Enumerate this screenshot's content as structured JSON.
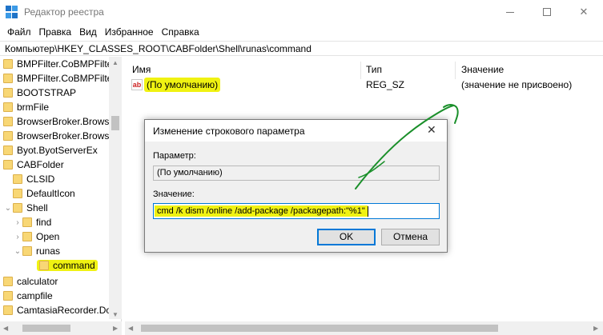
{
  "window": {
    "title": "Редактор реестра"
  },
  "menu": [
    "Файл",
    "Правка",
    "Вид",
    "Избранное",
    "Справка"
  ],
  "address": "Компьютер\\HKEY_CLASSES_ROOT\\CABFolder\\Shell\\runas\\command",
  "tree": [
    {
      "label": "BMPFilter.CoBMPFilte",
      "level": 0
    },
    {
      "label": "BMPFilter.CoBMPFilte",
      "level": 0
    },
    {
      "label": "BOOTSTRAP",
      "level": 0
    },
    {
      "label": "brmFile",
      "level": 0
    },
    {
      "label": "BrowserBroker.Browse",
      "level": 0
    },
    {
      "label": "BrowserBroker.Browse",
      "level": 0
    },
    {
      "label": "Byot.ByotServerEx",
      "level": 0
    },
    {
      "label": "CABFolder",
      "level": 0
    },
    {
      "label": "CLSID",
      "level": 1
    },
    {
      "label": "DefaultIcon",
      "level": 1
    },
    {
      "label": "Shell",
      "level": 1
    },
    {
      "label": "find",
      "level": 2
    },
    {
      "label": "Open",
      "level": 2
    },
    {
      "label": "runas",
      "level": 2
    },
    {
      "label": "command",
      "level": 3
    },
    {
      "label": "calculator",
      "level": 0
    },
    {
      "label": "campfile",
      "level": 0
    },
    {
      "label": "CamtasiaRecorder.Doc",
      "level": 0
    }
  ],
  "list": {
    "headers": {
      "name": "Имя",
      "type": "Тип",
      "value": "Значение"
    },
    "rows": [
      {
        "name": "(По умолчанию)",
        "type": "REG_SZ",
        "value": "(значение не присвоено)"
      }
    ]
  },
  "dialog": {
    "title": "Изменение строкового параметра",
    "param_label": "Параметр:",
    "param_value": "(По умолчанию)",
    "value_label": "Значение:",
    "value_text": "cmd /k dism /online /add-package /packagepath:\"%1\"",
    "ok_label": "OK",
    "cancel_label": "Отмена"
  },
  "colors": {
    "highlight": "#f0f212",
    "annotation": "#1a8f2a",
    "focus": "#0078d7"
  }
}
